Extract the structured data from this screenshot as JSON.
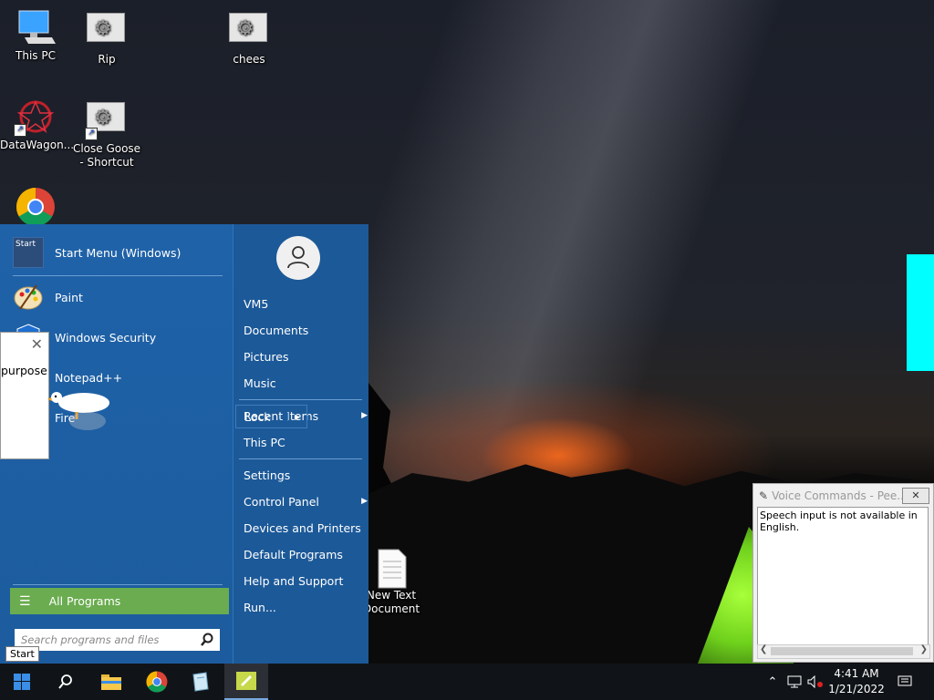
{
  "desktop": {
    "icons": [
      {
        "label": "This PC"
      },
      {
        "label": "Rip"
      },
      {
        "label": "chees"
      },
      {
        "label": "DataWagon..."
      },
      {
        "label": "Close Goose - Shortcut"
      },
      {
        "label": "New Text Document"
      }
    ]
  },
  "start_menu": {
    "pinned": [
      {
        "label": "Start Menu (Windows)",
        "icon_text": "Start"
      },
      {
        "label": "Paint"
      },
      {
        "label": "Windows Security"
      },
      {
        "label": "Notepad++"
      },
      {
        "label": "Fire"
      }
    ],
    "all_programs": "All Programs",
    "search_placeholder": "Search programs and files",
    "right": {
      "user": "VM5",
      "items": [
        "Documents",
        "Pictures",
        "Music",
        "Recent Items",
        "This PC",
        "Settings",
        "Control Panel",
        "Devices and Printers",
        "Default Programs",
        "Help and Support",
        "Run..."
      ],
      "lock": "Lock"
    }
  },
  "popup": {
    "text": "purpose"
  },
  "voice_commands": {
    "title": "Voice Commands - Pee...",
    "message": "Speech input is not available in English."
  },
  "taskbar": {
    "start_tooltip": "Start",
    "time": "4:41 AM",
    "date": "1/21/2022"
  },
  "colors": {
    "start_menu_bg": "#1f5fa0",
    "all_programs_green": "#6aac4f",
    "accent_cyan": "#00ffff"
  }
}
